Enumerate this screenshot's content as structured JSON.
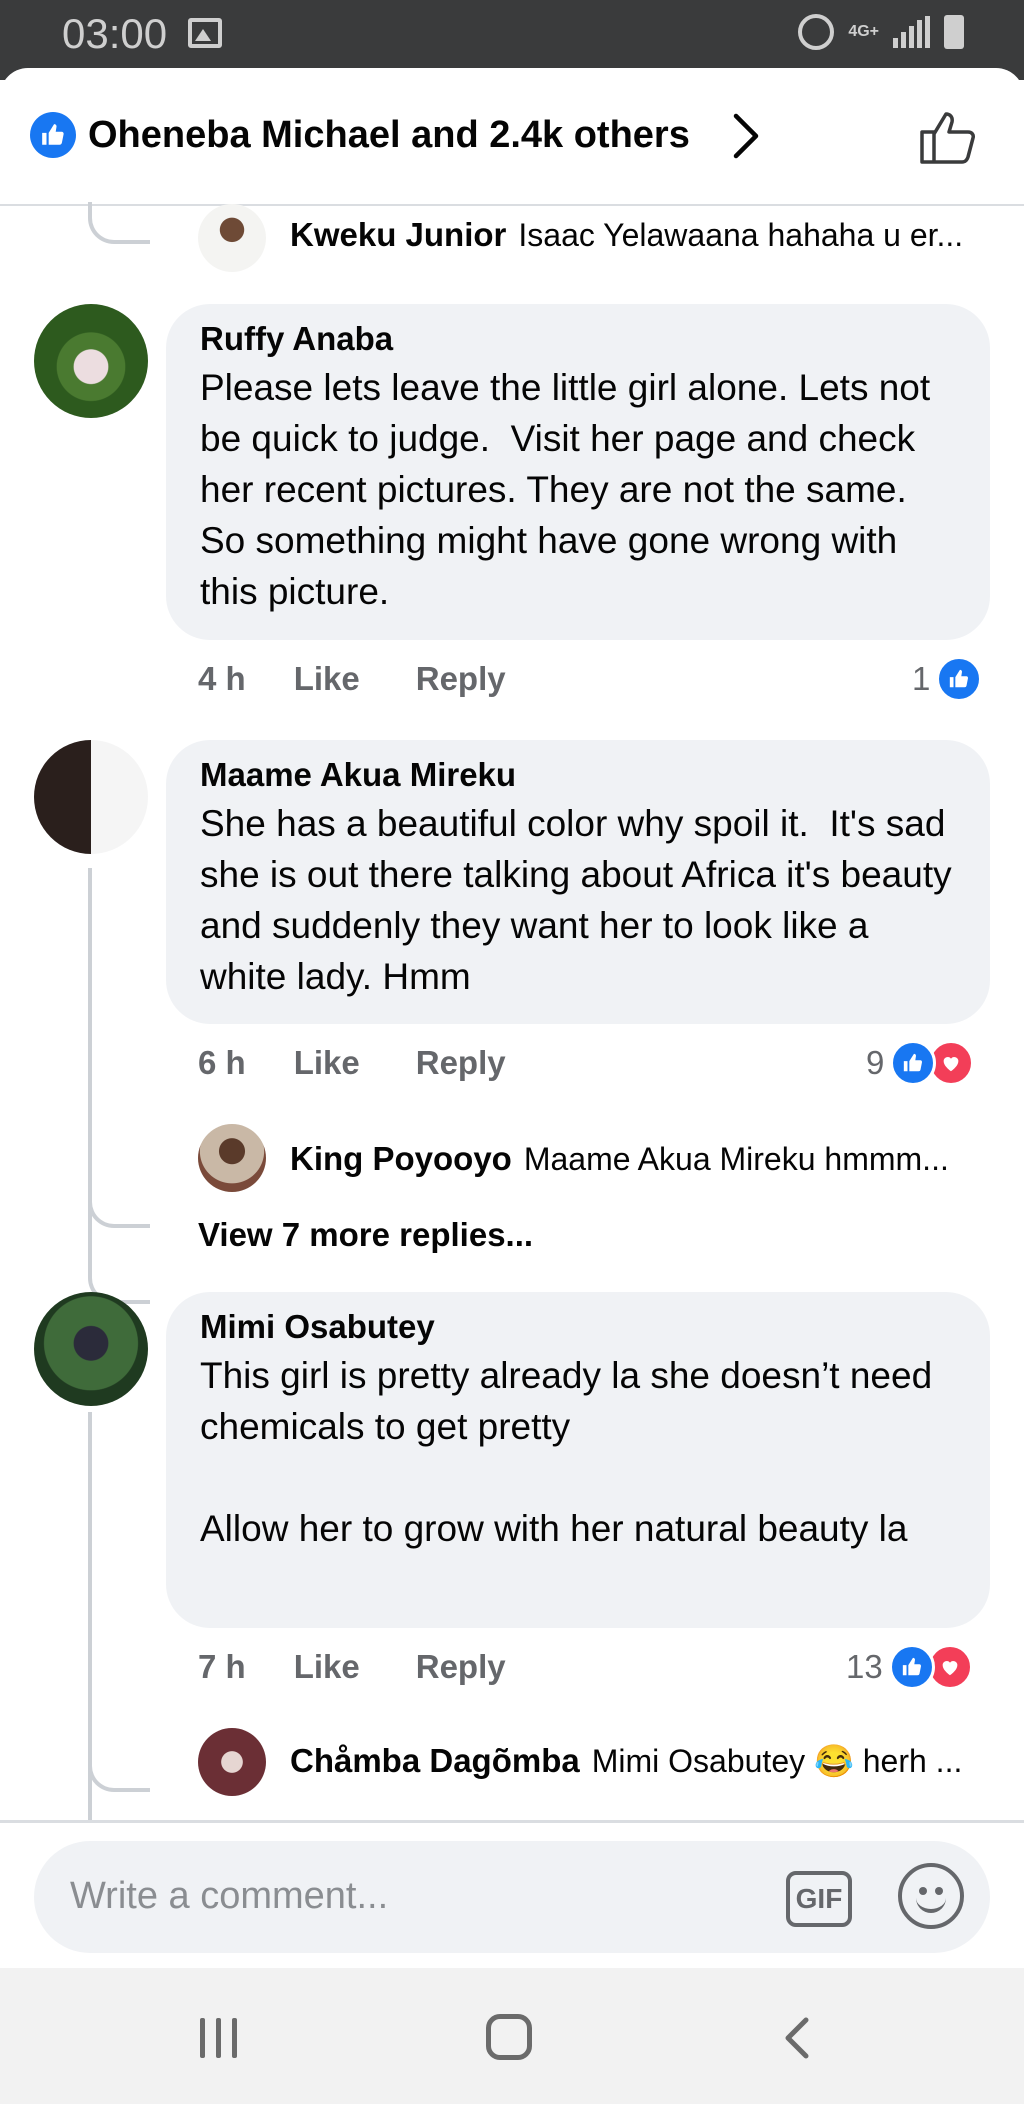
{
  "status_bar": {
    "time": "03:00",
    "network": "4G+"
  },
  "header": {
    "title": "Oheneba Michael and 2.4k others"
  },
  "comments": [
    {
      "author": "Ruffy Anaba",
      "text": "Please lets leave the little girl alone. Lets not be quick to judge.  Visit her page and check her recent pictures. They are not the same. So something might have gone wrong with this picture.",
      "time": "4 h",
      "like_label": "Like",
      "reply_label": "Reply",
      "reaction_count": "1"
    },
    {
      "author": "Maame Akua Mireku",
      "text": "She has a beautiful color why spoil it.  It's sad she is out there talking about Africa it's beauty and suddenly they want her to look like a white lady. Hmm",
      "time": "6 h",
      "like_label": "Like",
      "reply_label": "Reply",
      "reaction_count": "9"
    },
    {
      "author": "Mimi Osabutey",
      "text": "This girl is pretty already la she doesn’t need chemicals to get pretty\n\nAllow her to grow with her natural beauty la",
      "time": "7 h",
      "like_label": "Like",
      "reply_label": "Reply",
      "reaction_count": "13"
    }
  ],
  "replies": [
    {
      "author": "Kweku Junior",
      "preview": "Isaac Yelawaana hahaha u er..."
    },
    {
      "author": "King Poyooyo",
      "preview": "Maame Akua Mireku hmmm..."
    },
    {
      "author": "Chåmba Dagõmba",
      "preview": "Mimi Osabutey 😂 herh ..."
    }
  ],
  "view_more_replies": "View 7 more replies...",
  "composer": {
    "placeholder": "Write a comment...",
    "gif_label": "GIF"
  },
  "colors": {
    "accent": "#1877f2",
    "love": "#f33e58",
    "bubble": "#f0f2f5",
    "meta": "#65676b"
  },
  "icons": [
    "like-badge-icon",
    "chevron-right-icon",
    "thumbs-up-icon",
    "gif-icon",
    "emoji-icon",
    "recent-apps-icon",
    "home-icon",
    "back-icon"
  ]
}
